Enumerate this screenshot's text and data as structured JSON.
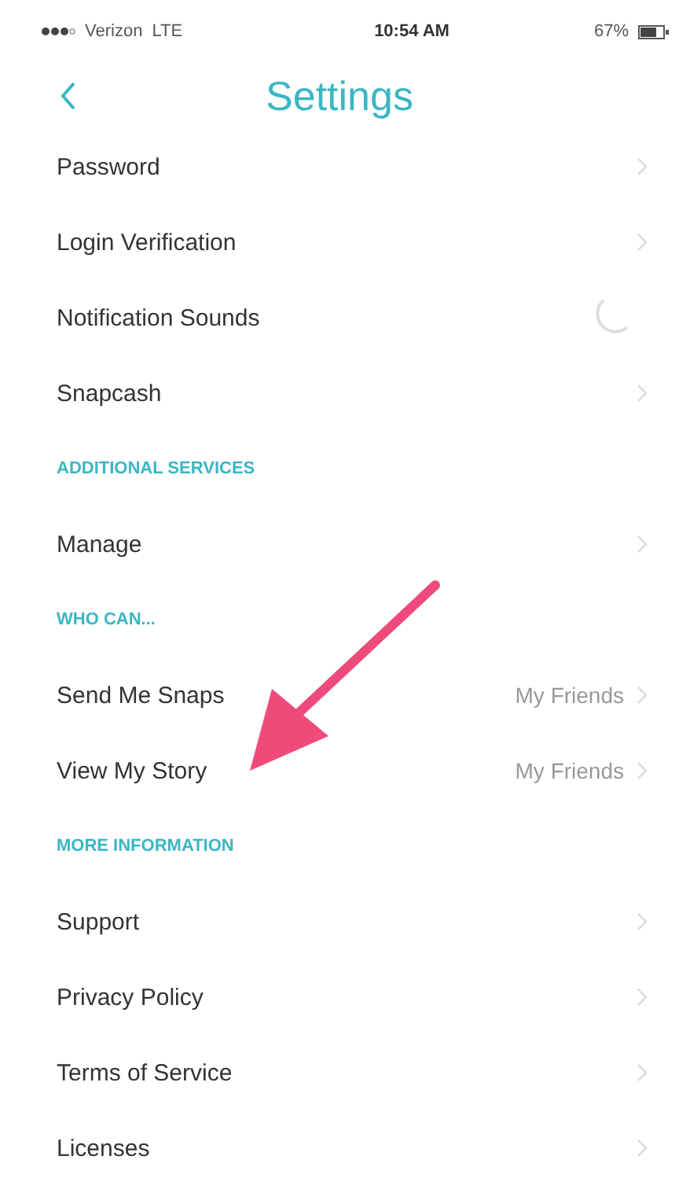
{
  "status_bar": {
    "carrier": "Verizon",
    "network": "LTE",
    "time": "10:54 AM",
    "battery": "67%"
  },
  "nav": {
    "title": "Settings"
  },
  "items": [
    {
      "kind": "row",
      "label": "Password"
    },
    {
      "kind": "row",
      "label": "Login Verification"
    },
    {
      "kind": "spinner",
      "label": "Notification Sounds"
    },
    {
      "kind": "row",
      "label": "Snapcash"
    },
    {
      "kind": "header",
      "label": "ADDITIONAL SERVICES"
    },
    {
      "kind": "row",
      "label": "Manage"
    },
    {
      "kind": "header",
      "label": "WHO CAN..."
    },
    {
      "kind": "row",
      "label": "Send Me Snaps",
      "value": "My Friends"
    },
    {
      "kind": "row",
      "label": "View My Story",
      "value": "My Friends"
    },
    {
      "kind": "header",
      "label": "MORE INFORMATION"
    },
    {
      "kind": "row",
      "label": "Support"
    },
    {
      "kind": "row",
      "label": "Privacy Policy"
    },
    {
      "kind": "row",
      "label": "Terms of Service"
    },
    {
      "kind": "row",
      "label": "Licenses"
    }
  ]
}
